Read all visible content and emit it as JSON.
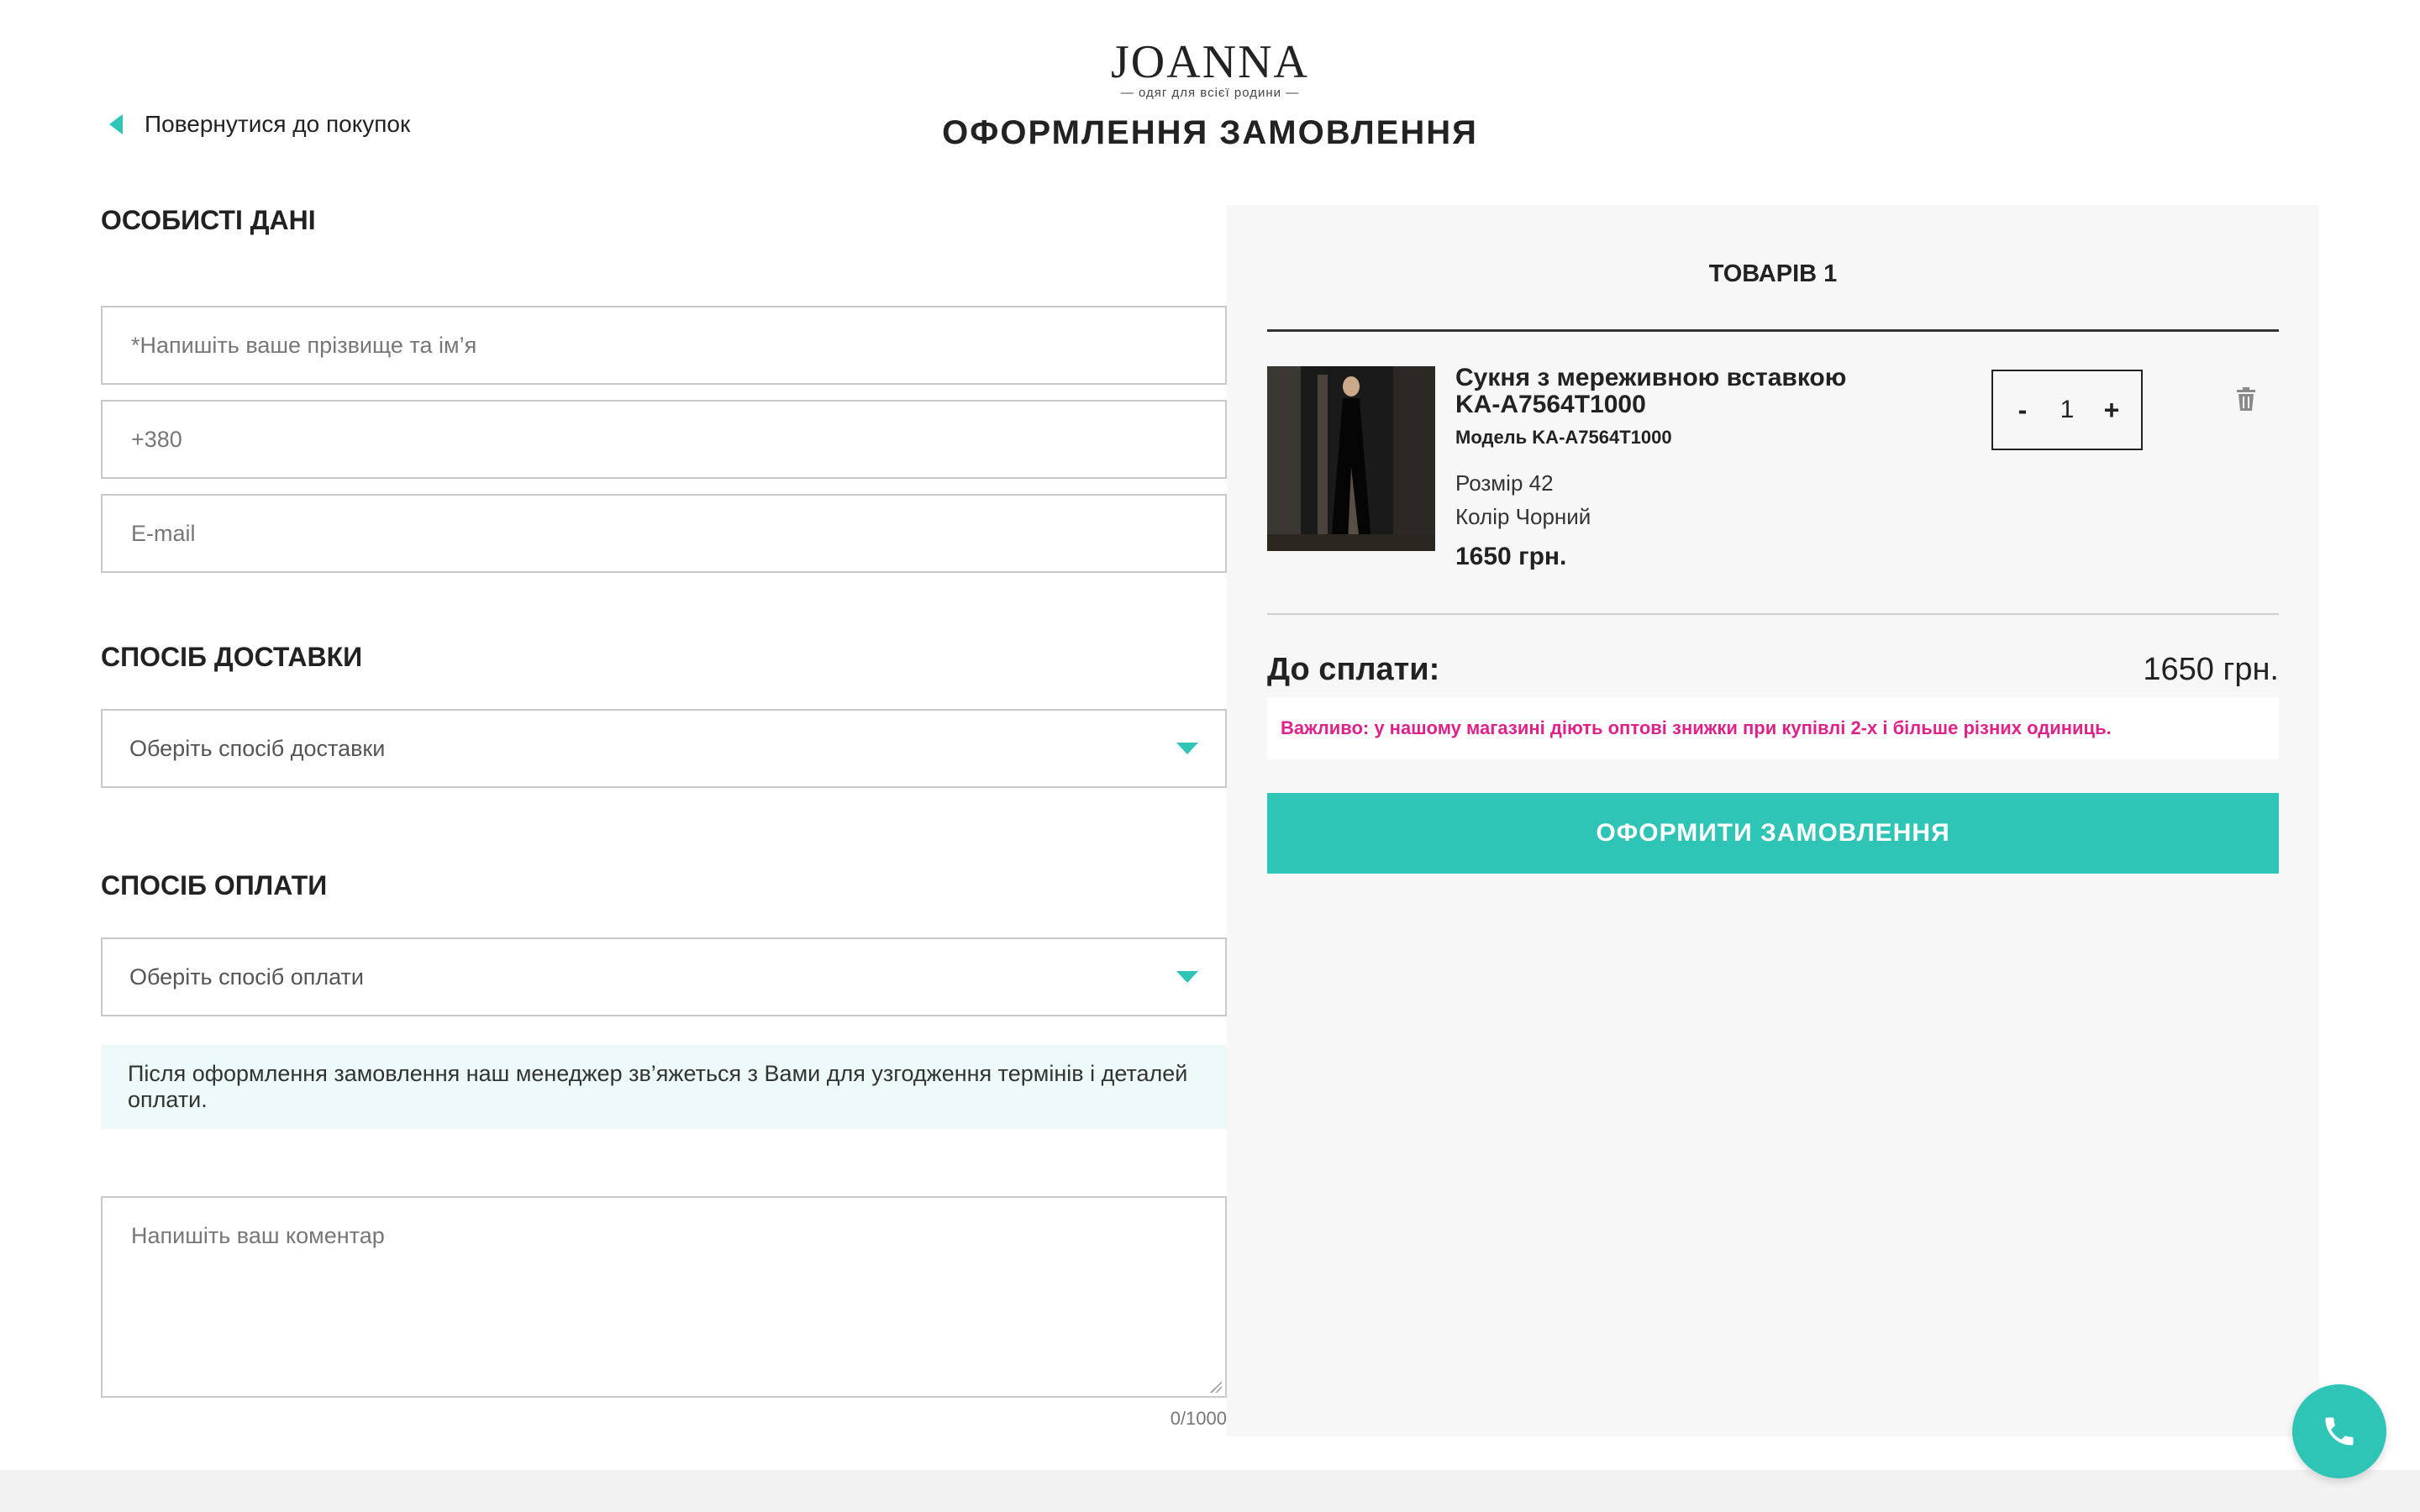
{
  "header": {
    "logo_text": "JOANNA",
    "logo_subtitle": "— одяг для всієї родини —",
    "back_link": "Повернутися до покупок",
    "page_title": "ОФОРМЛЕННЯ ЗАМОВЛЕННЯ"
  },
  "personal": {
    "heading": "ОСОБИСТІ ДАНІ",
    "name_placeholder": "*Напишіть ваше прізвище та ім’я",
    "phone_placeholder": "+380",
    "email_placeholder": "E-mail"
  },
  "delivery": {
    "heading": "СПОСІБ ДОСТАВКИ",
    "select_text": "Оберіть спосіб доставки"
  },
  "payment": {
    "heading": "СПОСІБ ОПЛАТИ",
    "select_text": "Оберіть спосіб оплати",
    "info": "Після оформлення замовлення наш менеджер зв’яжеться з Вами для узгодження термінів і деталей оплати."
  },
  "comment": {
    "placeholder": "Напишіть ваш коментар",
    "char_count": "0/1000"
  },
  "summary": {
    "items_count": "ТОВАРІВ 1",
    "product": {
      "name": "Сукня з мереживною вставкою KA-A7564T1000",
      "model": "Модель KA-A7564T1000",
      "size": "Розмір 42",
      "color": "Колір Чорний",
      "price": "1650 грн.",
      "quantity": "1",
      "minus": "-",
      "plus": "+"
    },
    "total_label": "До сплати:",
    "total_value": "1650 грн.",
    "notice": "Важливо: у нашому магазині діють оптові знижки при купівлі 2-х і більше різних одиниць.",
    "submit_label": "ОФОРМИТИ ЗАМОВЛЕННЯ"
  },
  "colors": {
    "accent": "#2ec4b6",
    "notice": "#e0218a",
    "panel_bg": "#f7f7f7",
    "info_bg": "#ecf9f8"
  },
  "icons": [
    "chevron-left-icon",
    "chevron-down-icon",
    "trash-icon",
    "phone-icon"
  ]
}
